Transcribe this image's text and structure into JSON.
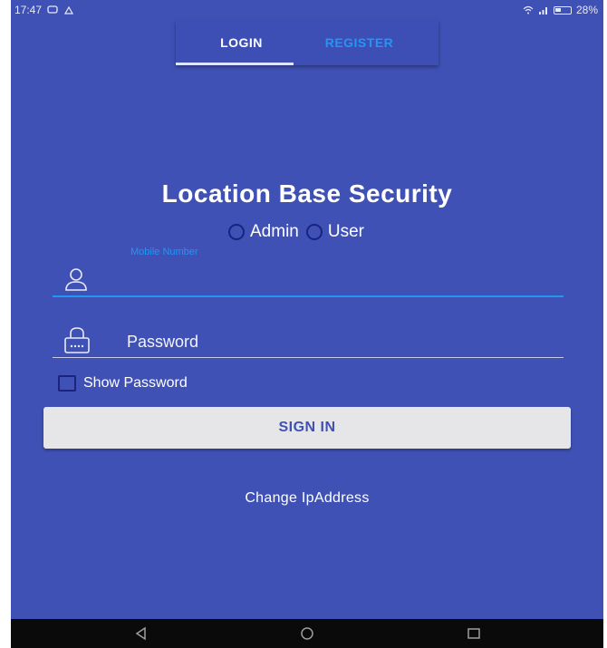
{
  "status_bar": {
    "time": "17:47",
    "battery": "28%",
    "icons": [
      "message-icon",
      "notification-icon",
      "wifi-icon",
      "signal-icon",
      "battery-icon"
    ]
  },
  "tabs": [
    {
      "label": "LOGIN",
      "active": true
    },
    {
      "label": "REGISTER",
      "active": false
    }
  ],
  "title": "Location Base Security",
  "roles": [
    {
      "label": "Admin",
      "selected": false
    },
    {
      "label": "User",
      "selected": false
    }
  ],
  "mobile": {
    "label": "Mobile Number",
    "value": "",
    "icon": "user-icon"
  },
  "password": {
    "placeholder": "Password",
    "value": "",
    "icon": "lock-icon"
  },
  "show_password": {
    "label": "Show Password",
    "checked": false
  },
  "sign_in_label": "SIGN IN",
  "change_ip_label": "Change IpAddress",
  "nav": [
    "back-icon",
    "home-icon",
    "recents-icon"
  ],
  "colors": {
    "background": "#3f51b5",
    "accent": "#2196f3",
    "button": "#e6e6e8"
  }
}
